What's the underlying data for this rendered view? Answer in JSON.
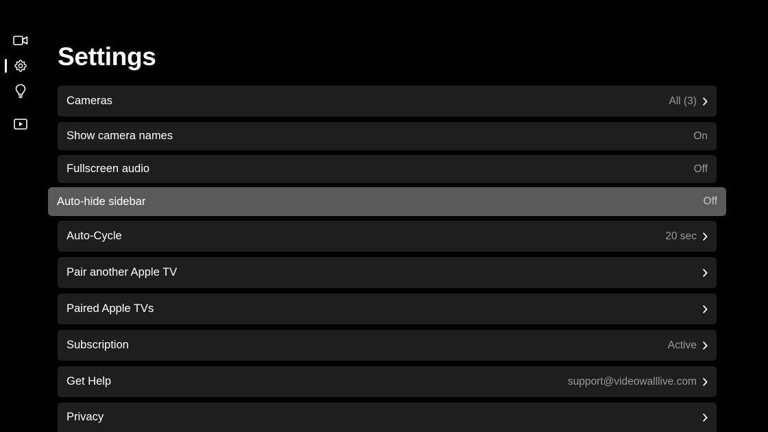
{
  "page": {
    "title": "Settings"
  },
  "sidebar": {
    "items": [
      {
        "name": "cameras",
        "icon": "video-camera-icon",
        "selected": false
      },
      {
        "name": "settings",
        "icon": "gear-icon",
        "selected": true
      },
      {
        "name": "tips",
        "icon": "lightbulb-icon",
        "selected": false
      },
      {
        "name": "play",
        "icon": "play-icon",
        "selected": false
      }
    ]
  },
  "settings": {
    "rows": [
      {
        "label": "Cameras",
        "value": "All (3)",
        "chevron": true,
        "focused": false
      },
      {
        "label": "Show camera names",
        "value": "On",
        "chevron": false,
        "focused": false
      },
      {
        "label": "Fullscreen audio",
        "value": "Off",
        "chevron": false,
        "focused": false
      },
      {
        "label": "Auto-hide sidebar",
        "value": "Off",
        "chevron": false,
        "focused": true
      },
      {
        "label": "Auto-Cycle",
        "value": "20 sec",
        "chevron": true,
        "focused": false
      },
      {
        "label": "Pair another Apple TV",
        "value": "",
        "chevron": true,
        "focused": false
      },
      {
        "label": "Paired Apple TVs",
        "value": "",
        "chevron": true,
        "focused": false
      },
      {
        "label": "Subscription",
        "value": "Active",
        "chevron": true,
        "focused": false
      },
      {
        "label": "Get Help",
        "value": "support@videowalllive.com",
        "chevron": true,
        "focused": false
      },
      {
        "label": "Privacy",
        "value": "",
        "chevron": true,
        "focused": false
      }
    ]
  },
  "colors": {
    "background": "#000000",
    "row": "#1e1e1e",
    "row_focused": "#5a5a5a",
    "value_text": "#9a9a9a"
  }
}
